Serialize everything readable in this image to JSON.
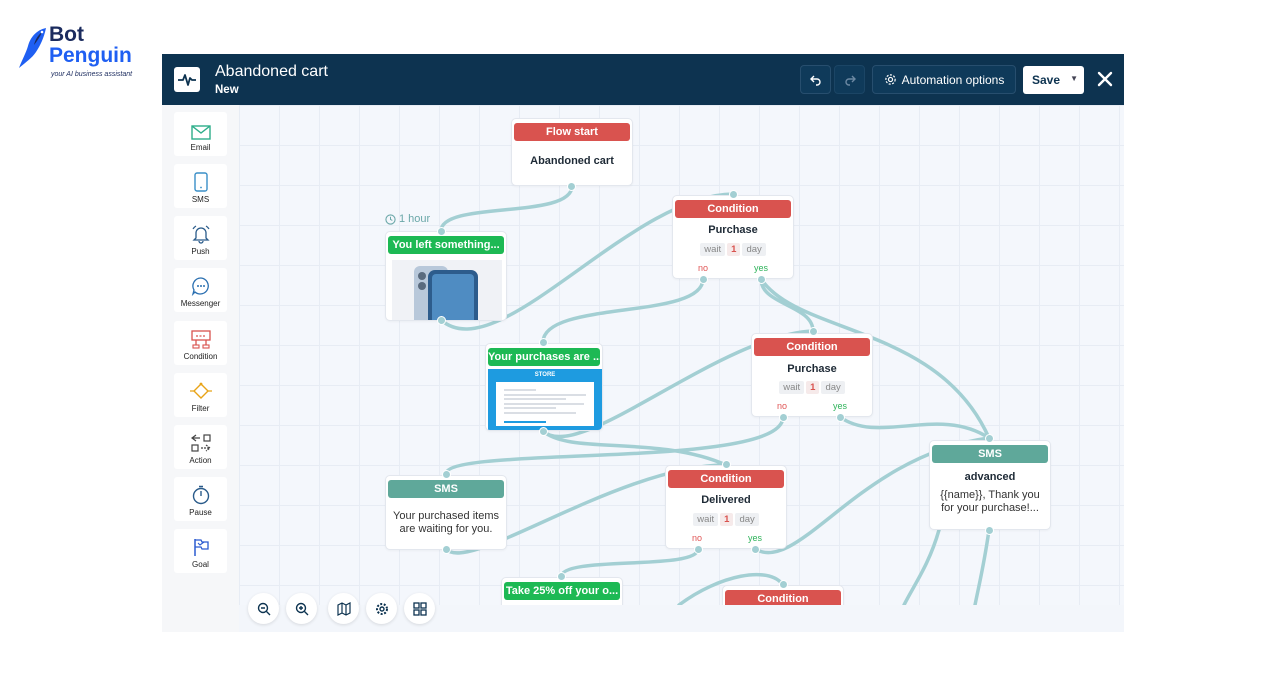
{
  "brand": {
    "line1": "Bot",
    "line2": "Penguin",
    "tagline": "your AI business assistant"
  },
  "header": {
    "title": "Abandoned cart",
    "subtitle": "New",
    "automation_options": "Automation options",
    "save": "Save"
  },
  "sidebar": {
    "items": [
      "Email",
      "SMS",
      "Push",
      "Messenger",
      "Condition",
      "Filter",
      "Action",
      "Pause",
      "Goal"
    ]
  },
  "nodes": {
    "flow_start": {
      "header": "Flow start",
      "title": "Abandoned cart"
    },
    "delay": {
      "label": "1 hour"
    },
    "email1": {
      "header": "You left something..."
    },
    "cond1": {
      "header": "Condition",
      "title": "Purchase",
      "wait": "wait",
      "num": "1",
      "unit": "day",
      "no": "no",
      "yes": "yes"
    },
    "email2": {
      "header": "Your purchases are ...",
      "store": "STORE"
    },
    "cond2": {
      "header": "Condition",
      "title": "Purchase",
      "wait": "wait",
      "num": "1",
      "unit": "day",
      "no": "no",
      "yes": "yes"
    },
    "sms1": {
      "header": "SMS",
      "text": "Your purchased items are waiting for you."
    },
    "cond3": {
      "header": "Condition",
      "title": "Delivered",
      "wait": "wait",
      "num": "1",
      "unit": "day",
      "no": "no",
      "yes": "yes"
    },
    "sms2": {
      "header": "SMS",
      "title": "advanced",
      "text": "{{name}}, Thank you for your purchase!..."
    },
    "email3": {
      "header": "Take 25% off your o..."
    },
    "cond4": {
      "header": "Condition"
    }
  },
  "colors": {
    "header_bg": "#0d3350",
    "condition": "#d9534f",
    "email": "#1db954",
    "sms": "#5fa89a",
    "wire": "#a3cfd3"
  }
}
